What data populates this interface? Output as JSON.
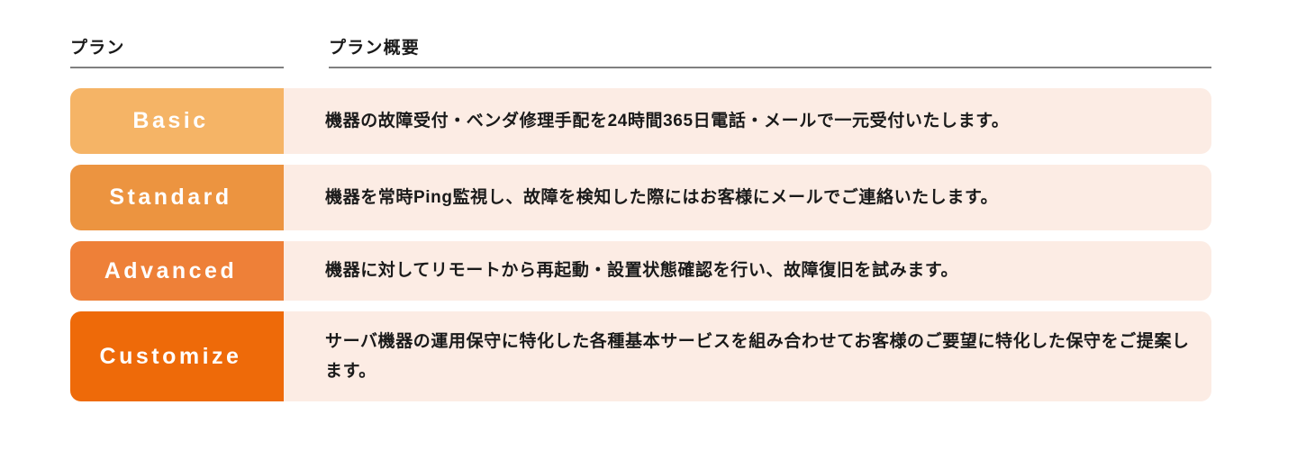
{
  "table": {
    "headers": {
      "plan": "プラン",
      "summary": "プラン概要"
    },
    "rows": [
      {
        "plan": "Basic",
        "color": "#F5B466",
        "summary": "機器の故障受付・ベンダ修理手配を24時間365日電話・メールで一元受付いたします。"
      },
      {
        "plan": "Standard",
        "color": "#EC9440",
        "summary": "機器を常時Ping監視し、故障を検知した際にはお客様にメールでご連絡いたします。"
      },
      {
        "plan": "Advanced",
        "color": "#EE8038",
        "summary": "機器に対してリモートから再起動・設置状態確認を行い、故障復旧を試みます。"
      },
      {
        "plan": "Customize",
        "color": "#EE6A09",
        "summary": "サーバ機器の運用保守に特化した各種基本サービスを組み合わせてお客様のご要望に特化した保守をご提案します。"
      }
    ],
    "theme": {
      "row_background": "#FCECE4",
      "header_rule": "#808080",
      "text": "#1A1A1A",
      "badge_text": "#FFFFFF"
    }
  }
}
